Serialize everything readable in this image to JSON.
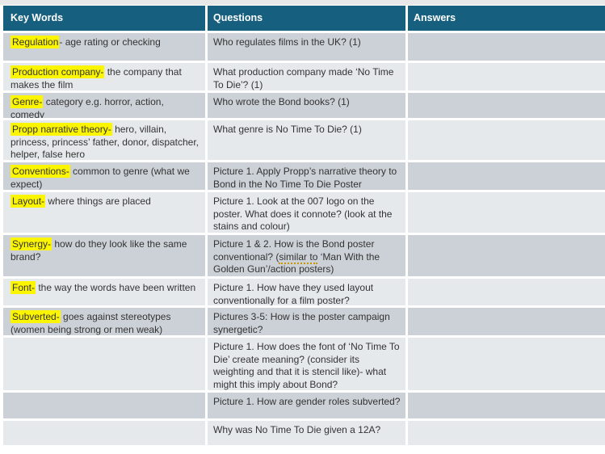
{
  "colors": {
    "header_bg": "#165f7f",
    "row_gray": "#ccd1d7",
    "row_light": "#e6e9ec",
    "top_strip": "#e8e8e8",
    "highlight_yellow": "#fcf500",
    "text": "#333333",
    "spellcheck_dotted": "#c99700"
  },
  "header": {
    "keywords": "Key Words",
    "questions": "Questions",
    "answers": "Answers"
  },
  "rows": [
    {
      "kw_highlight": "Regulation",
      "kw_rest": "- age rating or checking",
      "question": "Who regulates films in the UK? (1)",
      "answer": ""
    },
    {
      "kw_highlight": "Production company-",
      "kw_rest": " the company that makes the film",
      "question": "What production company made ‘No Time To Die’?  (1)",
      "answer": ""
    },
    {
      "kw_highlight": "Genre-",
      "kw_rest": " category e.g. horror, action, comedy",
      "question": "Who wrote the Bond books? (1)",
      "answer": ""
    },
    {
      "kw_highlight": "Propp narrative theory-",
      "kw_rest": " hero, villain, princess, princess’ father, donor, dispatcher, helper, false hero",
      "question": "What genre is No Time To Die?  (1)",
      "answer": ""
    },
    {
      "kw_highlight": "Conventions-",
      "kw_rest": " common to genre (what we expect)",
      "question": "Picture 1. Apply Propp’s narrative theory to Bond in the No Time To Die Poster",
      "answer": ""
    },
    {
      "kw_highlight": "Layout-",
      "kw_rest": " where things are placed",
      "question": "Picture 1. Look at the 007 logo on the poster. What does it connote?  (look at the stains and colour)",
      "answer": ""
    },
    {
      "kw_highlight": "Synergy-",
      "kw_rest": " how do they look like the same brand?",
      "question_parts": {
        "pre": "Picture 1 & 2. How is the Bond poster conventional? (",
        "dotted": "similar to",
        "post": " ‘Man With the Golden Gun’/action posters)"
      },
      "answer": ""
    },
    {
      "kw_highlight": "Font-",
      "kw_rest": " the way the words have been written",
      "question": "Picture 1. How have they used layout conventionally for a film poster?",
      "answer": ""
    },
    {
      "kw_highlight": "Subverted-",
      "kw_rest": " goes against stereotypes (women being strong or men weak)",
      "question": "Pictures 3-5: How is the poster campaign synergetic?",
      "answer": ""
    },
    {
      "kw_highlight": "",
      "kw_rest": "",
      "question": "Picture 1. How does the font of ‘No Time To Die’ create meaning? (consider its weighting and that it is stencil like)- what might this imply about Bond?",
      "answer": ""
    },
    {
      "kw_highlight": "",
      "kw_rest": "",
      "question": "Picture 1. How are gender roles subverted?",
      "answer": ""
    },
    {
      "kw_highlight": "",
      "kw_rest": "",
      "question": "Why was No Time To Die given a 12A?",
      "answer": ""
    }
  ]
}
